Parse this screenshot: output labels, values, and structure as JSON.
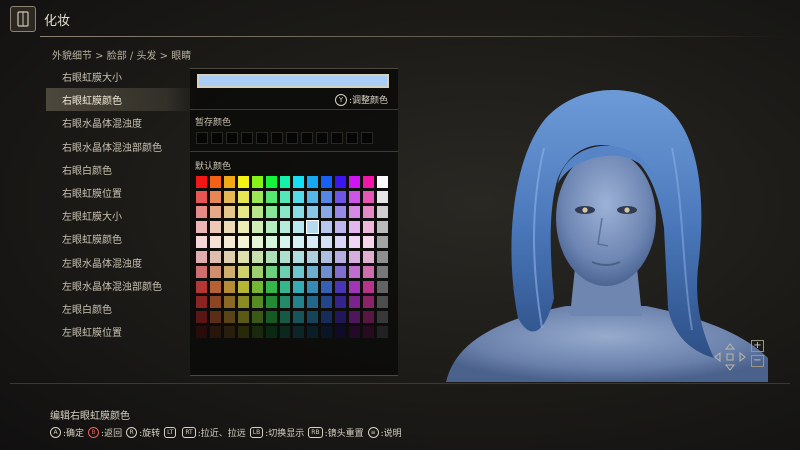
{
  "header": {
    "title": "化妆",
    "icon": "makeup-menu-icon"
  },
  "breadcrumb": "外貌细节 > 脸部 / 头发 > 眼睛",
  "options": [
    {
      "label": "右眼虹膜大小"
    },
    {
      "label": "右眼虹膜颜色"
    },
    {
      "label": "右眼水晶体混浊度"
    },
    {
      "label": "右眼水晶体混浊部颜色"
    },
    {
      "label": "右眼白颜色"
    },
    {
      "label": "右眼虹膜位置"
    },
    {
      "label": "左眼虹膜大小"
    },
    {
      "label": "左眼虹膜颜色"
    },
    {
      "label": "左眼水晶体混浊度"
    },
    {
      "label": "左眼水晶体混浊部颜色"
    },
    {
      "label": "左眼白颜色"
    },
    {
      "label": "左眼虹膜位置"
    }
  ],
  "selected_option": "右眼虹膜颜色",
  "color_panel": {
    "current_color": "#a9cdf5",
    "adjust_button": "Y",
    "adjust_label": ":调整颜色",
    "saved_label": "暂存颜色",
    "default_label": "默认颜色",
    "saved_slots": 12
  },
  "footer": {
    "title": "编辑右眼虹膜颜色",
    "hints": [
      {
        "button": "A",
        "label": ":确定",
        "shape": "circle",
        "btn_color": "#d8d2c2"
      },
      {
        "button": "B",
        "label": ":返回",
        "shape": "circle",
        "btn_color": "#e0645a"
      },
      {
        "button": "R",
        "label": ":旋转",
        "shape": "circle",
        "btn_color": "#d8d2c2"
      },
      {
        "button": "LT",
        "label": "",
        "shape": "rect",
        "btn_color": "#d8d2c2"
      },
      {
        "button": "RT",
        "label": ":拉近、拉远",
        "shape": "rect",
        "btn_color": "#d8d2c2"
      },
      {
        "button": "LB",
        "label": ":切换显示",
        "shape": "rect",
        "btn_color": "#d8d2c2"
      },
      {
        "button": "RB",
        "label": ":镜头重置",
        "shape": "rect",
        "btn_color": "#d8d2c2"
      },
      {
        "button": "≡",
        "label": ":说明",
        "shape": "circle",
        "btn_color": "#d8d2c2"
      }
    ]
  },
  "zoom": {
    "plus": "+",
    "minus": "−"
  },
  "colors": {
    "accent": "#d8d2c2",
    "hair": "#4f7cc0",
    "skin": "#7f96bf"
  }
}
